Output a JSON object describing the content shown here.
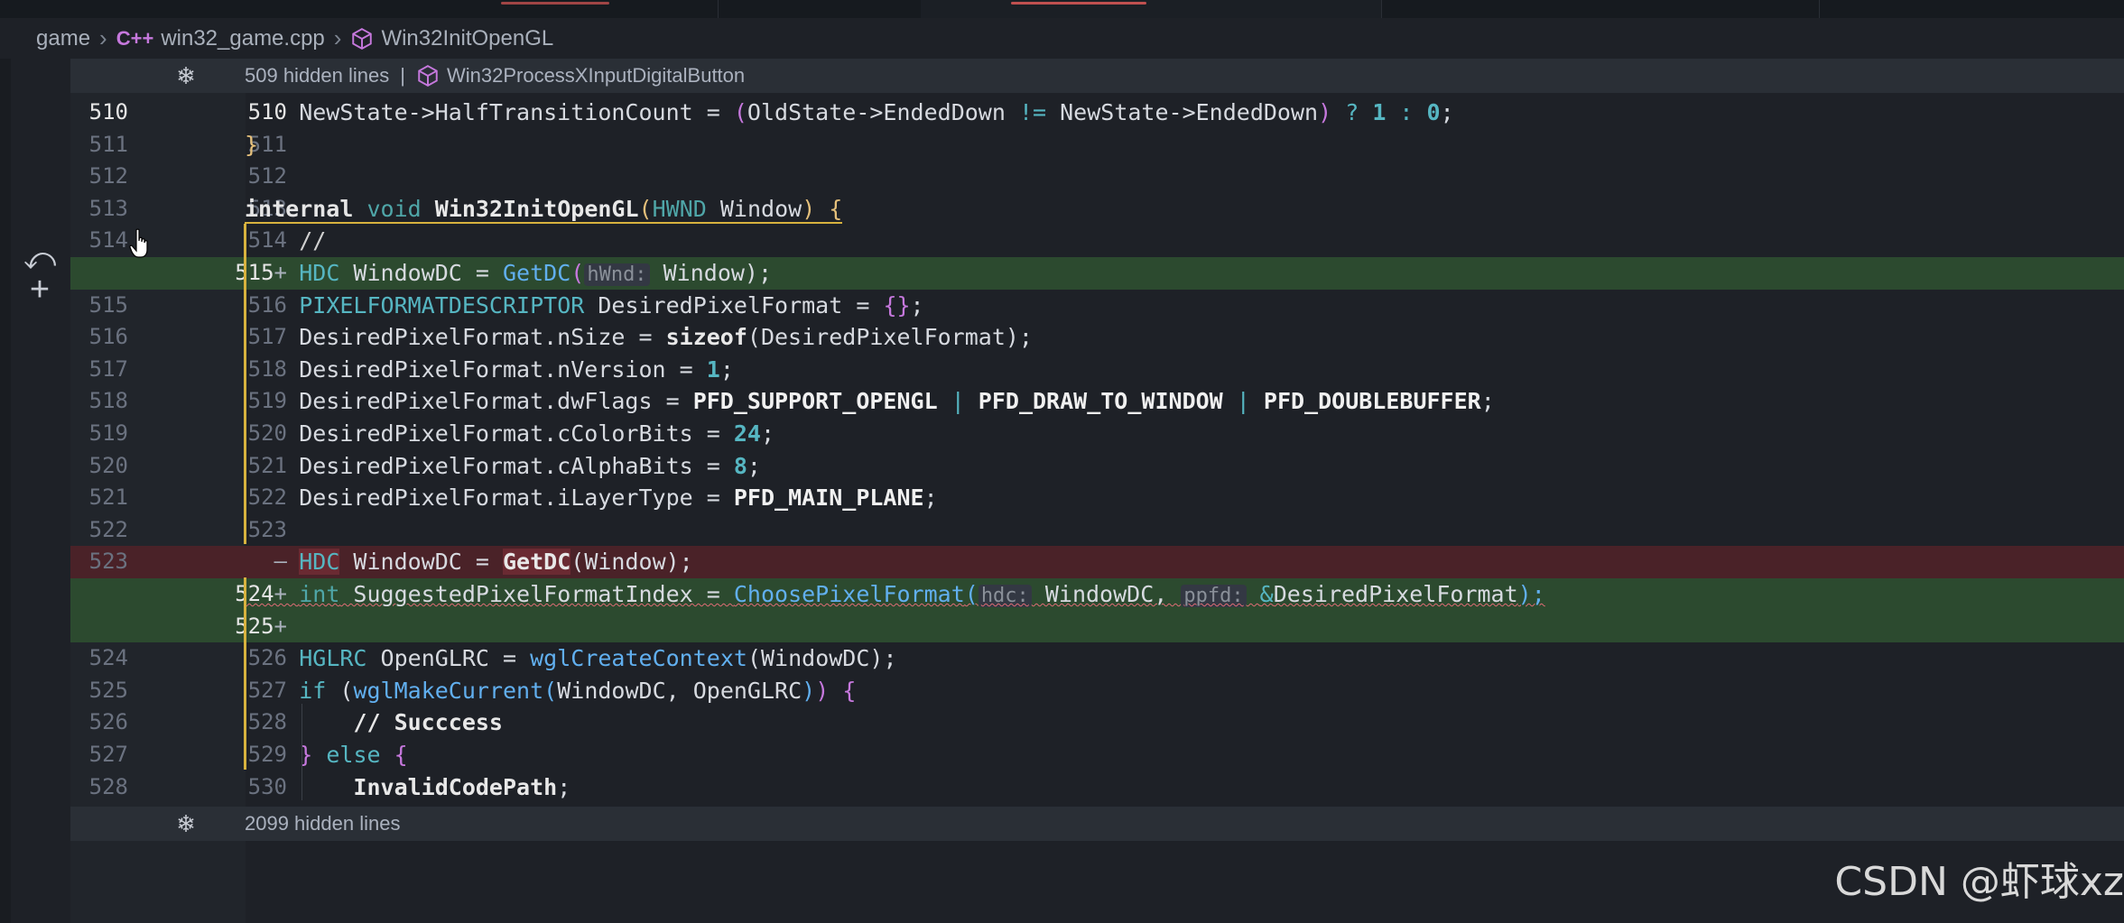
{
  "breadcrumb": {
    "root": "game",
    "file": "win32_game.cpp",
    "symbol": "Win32InitOpenGL"
  },
  "hidden_top": {
    "label": "509 hidden lines",
    "symbol": "Win32ProcessXInputDigitalButton"
  },
  "hidden_bottom": {
    "label": "2099 hidden lines"
  },
  "lines": [
    {
      "old": "510",
      "new": "510",
      "mark": "",
      "kind": "normal"
    },
    {
      "old": "511",
      "new": "511",
      "mark": "",
      "kind": "normal"
    },
    {
      "old": "512",
      "new": "512",
      "mark": "",
      "kind": "normal"
    },
    {
      "old": "513",
      "new": "513",
      "mark": "",
      "kind": "normal"
    },
    {
      "old": "514",
      "new": "514",
      "mark": "",
      "kind": "normal"
    },
    {
      "old": "",
      "new": "515",
      "mark": "+",
      "kind": "added"
    },
    {
      "old": "515",
      "new": "516",
      "mark": "",
      "kind": "normal"
    },
    {
      "old": "516",
      "new": "517",
      "mark": "",
      "kind": "normal"
    },
    {
      "old": "517",
      "new": "518",
      "mark": "",
      "kind": "normal"
    },
    {
      "old": "518",
      "new": "519",
      "mark": "",
      "kind": "normal"
    },
    {
      "old": "519",
      "new": "520",
      "mark": "",
      "kind": "normal"
    },
    {
      "old": "520",
      "new": "521",
      "mark": "",
      "kind": "normal"
    },
    {
      "old": "521",
      "new": "522",
      "mark": "",
      "kind": "normal"
    },
    {
      "old": "522",
      "new": "523",
      "mark": "",
      "kind": "normal"
    },
    {
      "old": "523",
      "new": "",
      "mark": "—",
      "kind": "removed"
    },
    {
      "old": "",
      "new": "524",
      "mark": "+",
      "kind": "added"
    },
    {
      "old": "",
      "new": "525",
      "mark": "+",
      "kind": "added"
    },
    {
      "old": "524",
      "new": "526",
      "mark": "",
      "kind": "normal"
    },
    {
      "old": "525",
      "new": "527",
      "mark": "",
      "kind": "normal"
    },
    {
      "old": "526",
      "new": "528",
      "mark": "",
      "kind": "normal"
    },
    {
      "old": "527",
      "new": "529",
      "mark": "",
      "kind": "normal"
    },
    {
      "old": "528",
      "new": "530",
      "mark": "",
      "kind": "normal"
    }
  ],
  "code": {
    "l510": [
      "    NewState->HalfTransitionCount = ",
      "(",
      "OldState->EndedDown ",
      "!=",
      " NewState->EndedDown",
      ")",
      " ? ",
      "1",
      " : ",
      "0",
      ";"
    ],
    "l511": "}",
    "l513": [
      "internal",
      " ",
      "void",
      " ",
      "Win32InitOpenGL",
      "(",
      "HWND",
      " Window",
      ")",
      " {"
    ],
    "l514": "    //",
    "l515": [
      "    ",
      "HDC",
      " WindowDC = ",
      "GetDC",
      "(",
      "hWnd:",
      " Window",
      ");"
    ],
    "l516": [
      "    ",
      "PIXELFORMATDESCRIPTOR",
      " DesiredPixelFormat = ",
      "{}",
      ";"
    ],
    "l517": [
      "    DesiredPixelFormat.nSize = ",
      "sizeof",
      "(DesiredPixelFormat);"
    ],
    "l518": [
      "    DesiredPixelFormat.nVersion = ",
      "1",
      ";"
    ],
    "l519": [
      "    DesiredPixelFormat.dwFlags = ",
      "PFD_SUPPORT_OPENGL",
      " | ",
      "PFD_DRAW_TO_WINDOW",
      " | ",
      "PFD_DOUBLEBUFFER",
      ";"
    ],
    "l520": [
      "    DesiredPixelFormat.cColorBits = ",
      "24",
      ";"
    ],
    "l521": [
      "    DesiredPixelFormat.cAlphaBits = ",
      "8",
      ";"
    ],
    "l522": [
      "    DesiredPixelFormat.iLayerType = ",
      "PFD_MAIN_PLANE",
      ";"
    ],
    "l523": [
      "    ",
      "HDC",
      " WindowDC = ",
      "GetDC",
      "(Window);"
    ],
    "l524": [
      "    ",
      "int",
      " SuggestedPixelFormatIndex = ",
      "ChoosePixelFormat",
      "(",
      "hdc:",
      " WindowDC, ",
      "ppfd:",
      " ",
      "&",
      "DesiredPixelFormat",
      ");"
    ],
    "l526": [
      "    ",
      "HGLRC",
      " OpenGLRC = ",
      "wglCreateContext",
      "(WindowDC);"
    ],
    "l527": [
      "    ",
      "if",
      " (",
      "wglMakeCurrent",
      "(",
      "WindowDC, OpenGLRC",
      ")",
      ")",
      " {"
    ],
    "l528": [
      "        ",
      "// Succcess"
    ],
    "l529": [
      "    ",
      "}",
      " ",
      "else",
      " ",
      "{"
    ],
    "l530": [
      "        ",
      "InvalidCodePath",
      ";"
    ]
  },
  "watermark": "CSDN @虾球xz",
  "colors": {
    "added_bg": "#2c4a2f",
    "removed_bg": "#4a2228",
    "modified_bar": "#d7b23e",
    "background": "#1e2127"
  }
}
